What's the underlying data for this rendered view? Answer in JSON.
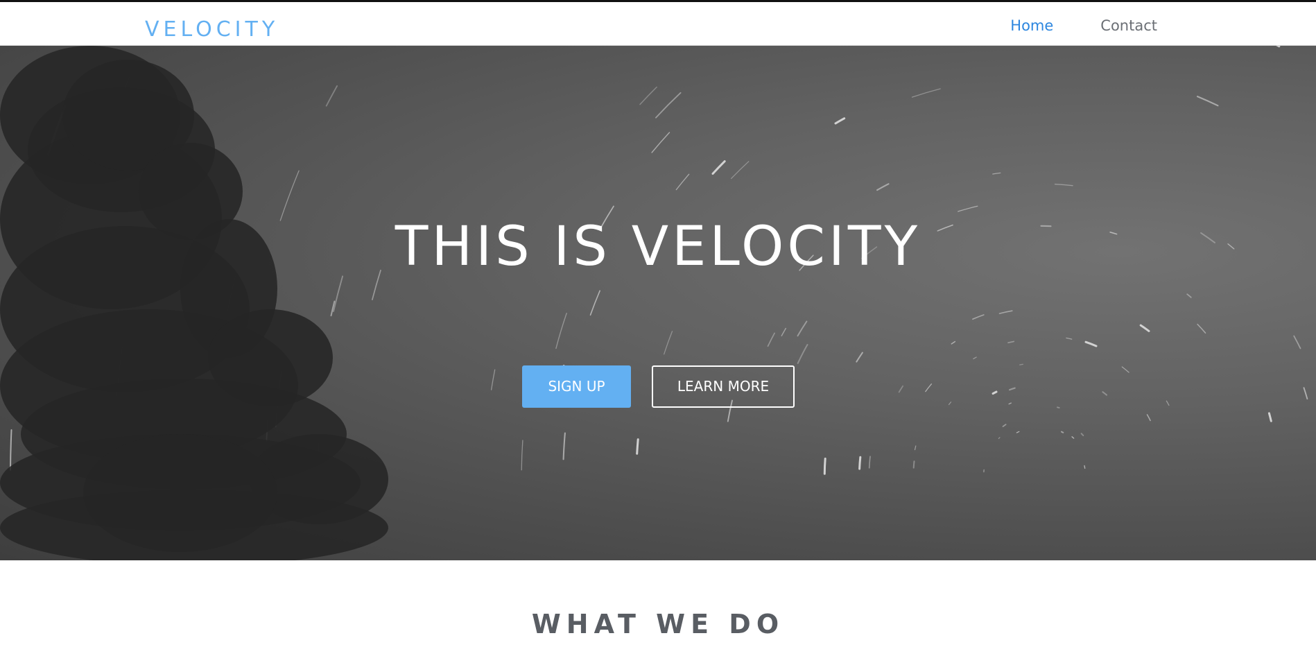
{
  "navbar": {
    "brand": "VELOCITY",
    "links": [
      {
        "label": "Home",
        "active": true
      },
      {
        "label": "Contact",
        "active": false
      }
    ]
  },
  "hero": {
    "title": "THIS IS VELOCITY",
    "signup_label": "SIGN UP",
    "learn_more_label": "LEARN MORE",
    "background": "star-trails-night-sky-with-tree-silhouette"
  },
  "section": {
    "title": "WHAT WE DO"
  },
  "colors": {
    "accent": "#63b0f2",
    "nav_active": "#2c86df",
    "nav_inactive": "#6b6f75",
    "heading_gray": "#595d63"
  }
}
